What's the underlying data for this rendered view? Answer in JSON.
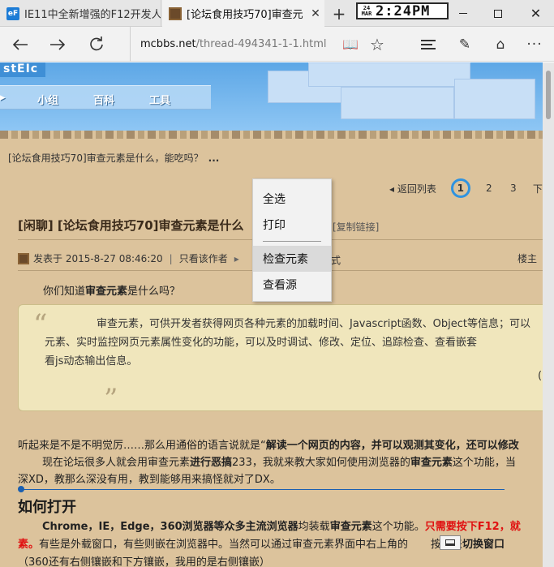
{
  "tabs": [
    {
      "title": "IE11中全新增强的F12开发人",
      "favicon": "ie-favicon",
      "active": false
    },
    {
      "title": "[论坛食用技巧70]审查元",
      "favicon": "minecraft-favicon",
      "active": true
    }
  ],
  "clock": {
    "date_top": "24",
    "date_bottom": "MAR",
    "time": "2:24PM"
  },
  "addressbar": {
    "url_domain": "mcbbs.net",
    "url_path": "/thread-494341-1-1.html"
  },
  "site_nav": {
    "logo_fragment": "stEIc",
    "items": [
      "小组",
      "百科",
      "工具"
    ]
  },
  "breadcrumb": {
    "text": "[论坛食用技巧70]审查元素是什么，能吃吗？",
    "more": "..."
  },
  "pager": {
    "back_label": "返回列表",
    "pages": [
      "1",
      "2",
      "3",
      "下"
    ],
    "current": "1"
  },
  "thread": {
    "title": "[闲聊] [论坛食用技巧70]审查元素是什么",
    "copy_link": "[复制链接]",
    "posted_at": "发表于 2015-8-27 08:46:20",
    "only_author": "只看该作者",
    "mode_fragment": "式",
    "floor": "楼主",
    "intro_before": "你们知道",
    "intro_bold": "审查元素",
    "intro_after": "是什么吗？",
    "quote_lines": [
      "审查元素，可供开发者获得网页各种元素的加载时间、Javascript函数、Object等信息；可以",
      "元素、实时监控网页元素属性变化的功能，可以及时调试、修改、定位、追踪检查、查看嵌套",
      "看js动态输出信息。"
    ],
    "quote_paren": "(",
    "p1_a": "听起来是不是不明觉厉……那么用通俗的语言说就是“",
    "p1_b": "解读一个网页的内容，并可以观测其变化，还可以修改",
    "p2_a": "现在论坛很多人就会用审查元素",
    "p2_b": "进行恶搞",
    "p2_c": "233，我就来教大家如何使用浏览器的",
    "p2_d": "审查元素",
    "p2_e": "这个功能，当",
    "p3": "深XD，教那么深没有用，教到能够用来搞怪就对了DX。",
    "heading": "如何打开",
    "p4_a": "Chrome，IE，Edge，360浏览器等众多主流浏览器",
    "p4_b": "均装载",
    "p4_c": "审查元素",
    "p4_d": "这个功能。",
    "p4_red": "只需要按下F12，就",
    "p5_red": "素。",
    "p5_a": "有些是外载窗口，有些则嵌在浏览器中。当然可以通过审查元素界面中右上角的",
    "p5_b": "按钮来",
    "p5_c": "切换窗口",
    "p6": "（360还有右侧镶嵌和下方镶嵌，我用的是右侧镶嵌）"
  },
  "context_menu": {
    "items": [
      "全选",
      "打印",
      "检查元素",
      "查看源"
    ],
    "highlighted": "检查元素"
  }
}
